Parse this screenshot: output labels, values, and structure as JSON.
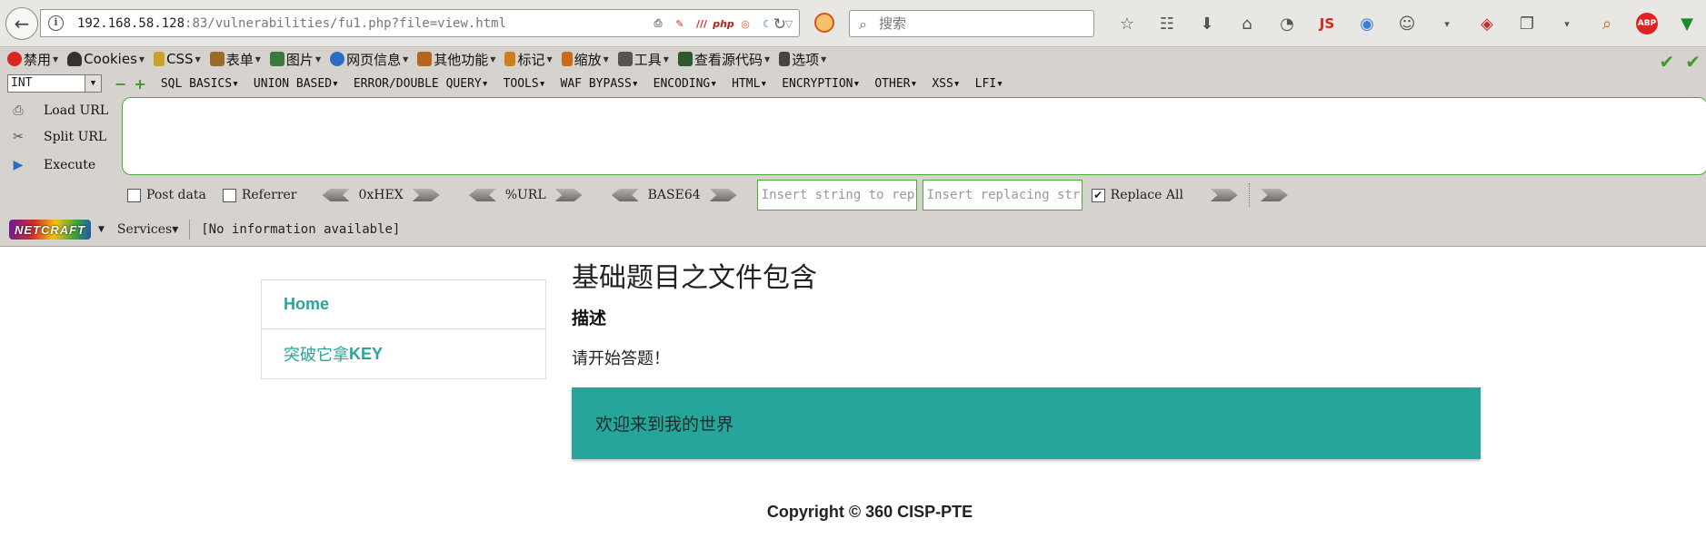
{
  "browser": {
    "url_host": "192.168.58.128",
    "url_rest": ":83/vulnerabilities/fu1.php?file=view.html",
    "search_placeholder": "搜索"
  },
  "menubar": [
    {
      "label": "禁用",
      "icon": "disable-icon",
      "color": "#d9251d"
    },
    {
      "label": "Cookies",
      "icon": "cookie-icon",
      "color": "#333333"
    },
    {
      "label": "CSS",
      "icon": "css-icon",
      "color": "#c9a227"
    },
    {
      "label": "表单",
      "icon": "form-icon",
      "color": "#9a6b2a"
    },
    {
      "label": "图片",
      "icon": "image-icon",
      "color": "#3b7a3b"
    },
    {
      "label": "网页信息",
      "icon": "info-icon",
      "color": "#2b6cc4"
    },
    {
      "label": "其他功能",
      "icon": "misc-icon",
      "color": "#b5651d"
    },
    {
      "label": "标记",
      "icon": "mark-icon",
      "color": "#d27d1d"
    },
    {
      "label": "缩放",
      "icon": "zoom-icon",
      "color": "#c96b1b"
    },
    {
      "label": "工具",
      "icon": "tools-icon",
      "color": "#555555"
    },
    {
      "label": "查看源代码",
      "icon": "source-icon",
      "color": "#2d5a2d"
    },
    {
      "label": "选项",
      "icon": "options-icon",
      "color": "#444444"
    }
  ],
  "hackbar": {
    "select_value": "INT",
    "menus": [
      "SQL BASICS",
      "UNION BASED",
      "ERROR/DOUBLE QUERY",
      "TOOLS",
      "WAF BYPASS",
      "ENCODING",
      "HTML",
      "ENCRYPTION",
      "OTHER",
      "XSS",
      "LFI"
    ],
    "load_url": "Load URL",
    "split_url": "Split URL",
    "execute": "Execute",
    "post_data": "Post data",
    "referrer": "Referrer",
    "enc_hex": "0xHEX",
    "enc_url": "%URL",
    "enc_base64": "BASE64",
    "replace_from_placeholder": "Insert string to replace",
    "replace_to_placeholder": "Insert replacing string",
    "replace_all": "Replace All"
  },
  "netcraft": {
    "logo": "NETCRAFT",
    "services": "Services",
    "info": "[No information available]"
  },
  "page": {
    "nav": [
      {
        "label": "Home"
      },
      {
        "label_prefix": "突破它拿",
        "label_key": "KEY"
      }
    ],
    "title": "基础题目之文件包含",
    "desc_heading": "描述",
    "desc_text": "请开始答题！",
    "banner": "欢迎来到我的世界",
    "footer": "Copyright © 360 CISP-PTE",
    "accent": "#26a69a"
  }
}
